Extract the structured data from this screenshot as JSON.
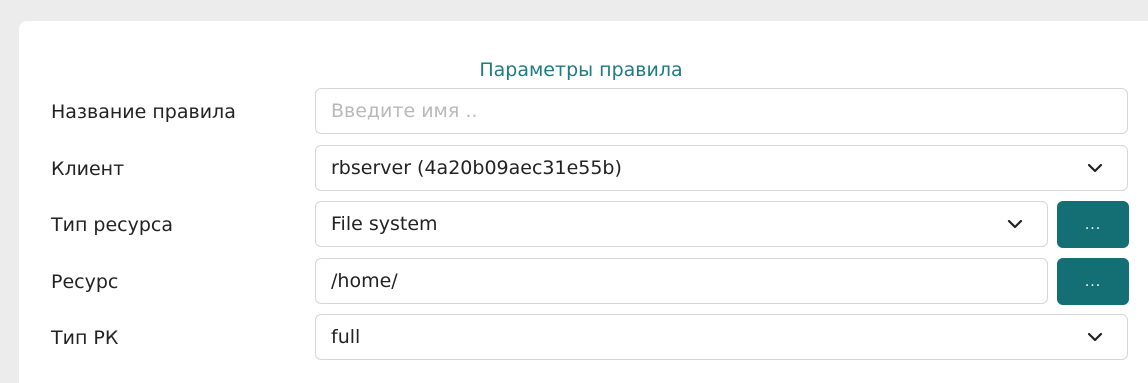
{
  "section": {
    "title": "Параметры правила"
  },
  "fields": {
    "name": {
      "label": "Название правила",
      "value": "",
      "placeholder": "Введите имя .."
    },
    "client": {
      "label": "Клиент",
      "value": "rbserver (4a20b09aec31e55b)",
      "icon": "chevron-down-icon"
    },
    "resource_type": {
      "label": "Тип ресурса",
      "value": "File system",
      "icon": "chevron-down-icon",
      "button_label": "..."
    },
    "resource": {
      "label": "Ресурс",
      "value": "/home/",
      "button_label": "..."
    },
    "backup_type": {
      "label": "Тип РК",
      "value": "full",
      "icon": "chevron-down-icon"
    }
  },
  "colors": {
    "accent": "#136f73",
    "title": "#1d7b82",
    "border": "#d6d6d6",
    "background": "#ececec"
  }
}
